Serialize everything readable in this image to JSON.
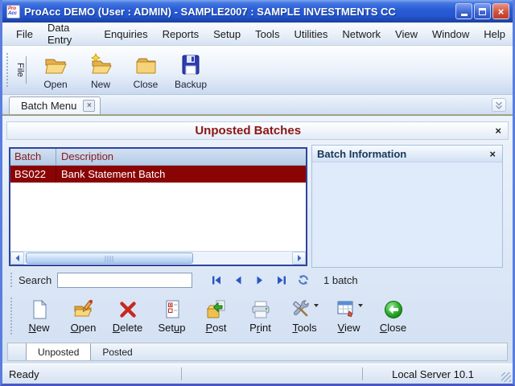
{
  "window": {
    "title": "ProAcc DEMO (User : ADMIN) - SAMPLE2007 : SAMPLE INVESTMENTS CC",
    "icon": {
      "line1": "Pro",
      "line2": "Acc"
    }
  },
  "menu": {
    "items": [
      "File",
      "Data Entry",
      "Enquiries",
      "Reports",
      "Setup",
      "Tools",
      "Utilities",
      "Network",
      "View",
      "Window",
      "Help"
    ]
  },
  "file_toolbar": {
    "group_label": "File",
    "buttons": [
      {
        "label": "Open",
        "icon": "open-folder-icon"
      },
      {
        "label": "New",
        "icon": "new-folder-icon"
      },
      {
        "label": "Close",
        "icon": "close-folder-icon"
      },
      {
        "label": "Backup",
        "icon": "backup-disk-icon"
      }
    ]
  },
  "tab_bar": {
    "tabs": [
      {
        "label": "Batch Menu",
        "active": true
      }
    ]
  },
  "batch_screen": {
    "title": "Unposted Batches",
    "table": {
      "columns": [
        "Batch",
        "Description"
      ],
      "rows": [
        {
          "batch": "BS022",
          "description": "Bank Statement Batch",
          "selected": true
        }
      ]
    },
    "info_panel": {
      "title": "Batch Information"
    },
    "search": {
      "label": "Search",
      "value": "",
      "count": "1 batch"
    },
    "actions": [
      {
        "name": "new",
        "pre": "",
        "key": "N",
        "post": "ew",
        "icon": "new-document-icon"
      },
      {
        "name": "open",
        "pre": "",
        "key": "O",
        "post": "pen",
        "icon": "open-edit-icon"
      },
      {
        "name": "delete",
        "pre": "",
        "key": "D",
        "post": "elete",
        "icon": "delete-x-icon"
      },
      {
        "name": "setup",
        "pre": "Set",
        "key": "u",
        "post": "p",
        "icon": "setup-checklist-icon"
      },
      {
        "name": "post",
        "pre": "",
        "key": "P",
        "post": "ost",
        "icon": "post-batch-icon"
      },
      {
        "name": "print",
        "pre": "P",
        "key": "r",
        "post": "int",
        "icon": "printer-icon"
      },
      {
        "name": "tools",
        "pre": "",
        "key": "T",
        "post": "ools",
        "icon": "tools-icon",
        "dropdown": true
      },
      {
        "name": "view",
        "pre": "",
        "key": "V",
        "post": "iew",
        "icon": "view-grid-icon",
        "dropdown": true
      },
      {
        "name": "close",
        "pre": "",
        "key": "C",
        "post": "lose",
        "icon": "close-green-arrow-icon"
      }
    ],
    "bottom_tabs": [
      {
        "label": "Unposted",
        "active": true
      },
      {
        "label": "Posted",
        "active": false
      }
    ]
  },
  "status_bar": {
    "left": "Ready",
    "right": "Local Server 10.1"
  },
  "colors": {
    "titlebar_blue": "#2a5cd8",
    "heading_red": "#8b1515",
    "selected_row_red": "#8b0404",
    "panel_blue": "#dfeafa",
    "frame_blue": "#5a7ee0"
  }
}
